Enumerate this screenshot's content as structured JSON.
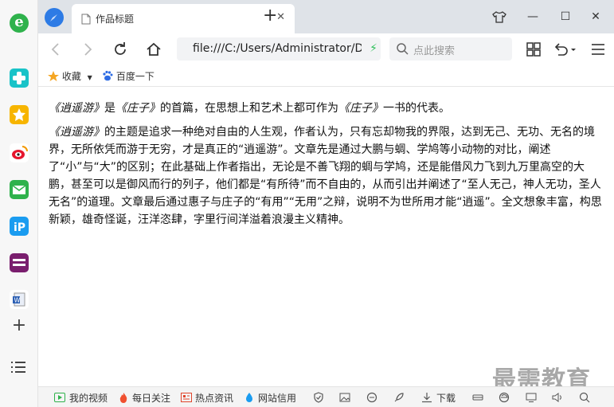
{
  "tab": {
    "title": "作品标题",
    "close": "✕",
    "new_tab": "+"
  },
  "window_controls": {
    "skin": "👕",
    "minimize": "—",
    "maximize": "☐",
    "close": "✕"
  },
  "address_bar": {
    "url": "file:///C:/Users/Administrator/Desktop"
  },
  "search": {
    "placeholder": "点此搜索"
  },
  "bookmarks": {
    "favorites": "收藏",
    "baidu": "百度一下"
  },
  "article": {
    "p1_title1": "《逍遥游》",
    "p1_mid": "是",
    "p1_title2": "《庄子》",
    "p1_mid2": "的首篇，在思想上和艺术上都可作为",
    "p1_title3": "《庄子》",
    "p1_end": "一书的代表。",
    "p2_title": "《逍遥游》",
    "p2_body": "的主题是追求一种绝对自由的人生观，作者认为，只有忘却物我的界限，达到无己、无功、无名的境界，无所依凭而游于无穷，才是真正的“逍遥游”。文章先是通过大鹏与蜩、学鸠等小动物的对比，阐述了“小”与“大”的区别；在此基础上作者指出，无论是不善飞翔的蜩与学鸠，还是能借风力飞到九万里高空的大鹏，甚至可以是御风而行的列子，他们都是“有所待”而不自由的，从而引出并阐述了“至人无己，神人无功，圣人无名”的道理。文章最后通过惠子与庄子的“有用”“无用”之辩，说明不为世所用才能“逍遥”。全文想象丰富，构思新颖，雄奇怪诞，汪洋恣肆，字里行间洋溢着浪漫主义精神。"
  },
  "watermark": "最需教育",
  "statusbar": {
    "my_video": "我的视频",
    "daily_focus": "每日关注",
    "hot_news": "热点资讯",
    "site_trust": "网站信用",
    "download": "下载"
  },
  "colors": {
    "accent_blue": "#2d7be5",
    "green": "#2fb24c"
  }
}
